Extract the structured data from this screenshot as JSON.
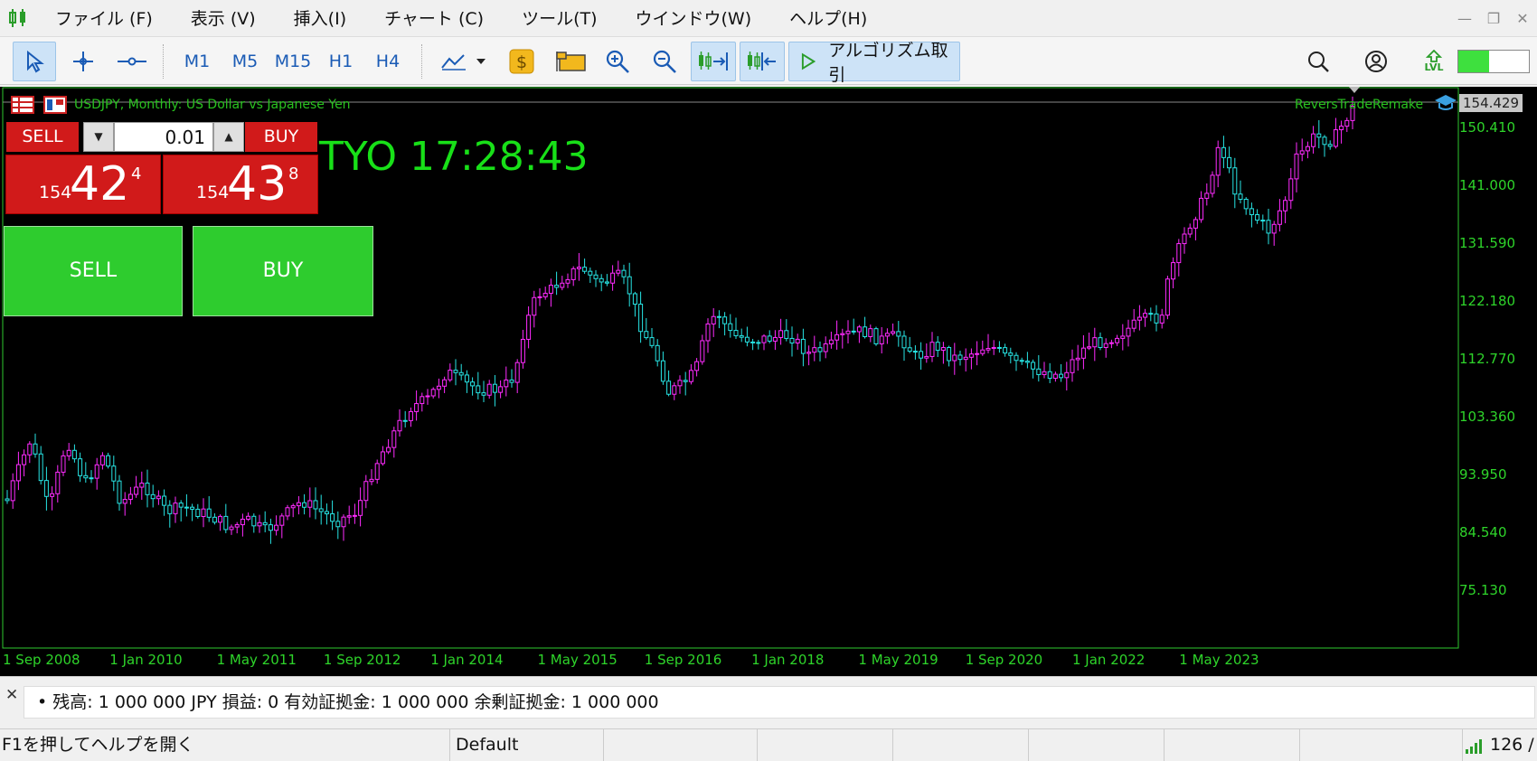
{
  "menu": {
    "items": [
      "ファイル (F)",
      "表示 (V)",
      "挿入(I)",
      "チャート (C)",
      "ツール(T)",
      "ウインドウ(W)",
      "ヘルプ(H)"
    ]
  },
  "toolbar": {
    "timeframes": [
      "M1",
      "M5",
      "M15",
      "H1",
      "H4"
    ],
    "algo_label": "アルゴリズム取引",
    "level_badge": "LVL"
  },
  "chart": {
    "title": "USDJPY, Monthly:  US Dollar vs Japanese Yen",
    "ea_name": "ReversTradeRemake",
    "last_price": "154.429",
    "price_labels": [
      "150.410",
      "141.000",
      "131.590",
      "122.180",
      "112.770",
      "103.360",
      "93.950",
      "84.540",
      "75.130"
    ],
    "date_labels": [
      "1 Sep 2008",
      "1 Jan 2010",
      "1 May 2011",
      "1 Sep 2012",
      "1 Jan 2014",
      "1 May 2015",
      "1 Sep 2016",
      "1 Jan 2018",
      "1 May 2019",
      "1 Sep 2020",
      "1 Jan 2022",
      "1 May 2023"
    ],
    "clock": "TYO 17:28:43",
    "colors": {
      "bull": "#ff2bff",
      "bear": "#27e5e5",
      "frame": "#2ec72e"
    }
  },
  "one_click": {
    "sell_label": "SELL",
    "buy_label": "BUY",
    "lot": "0.01",
    "sell_quote": {
      "prefix": "154",
      "big": "42",
      "sup": "4"
    },
    "buy_quote": {
      "prefix": "154",
      "big": "43",
      "sup": "8"
    }
  },
  "big_buttons": {
    "sell": "SELL",
    "buy": "BUY"
  },
  "trade_panel": {
    "summary": "•  残高: 1 000 000 JPY  損益: 0  有効証拠金: 1 000 000  余剰証拠金: 1 000 000"
  },
  "status_bar": {
    "help": "F1を押してヘルプを開く",
    "profile": "Default",
    "ping": "126 /"
  }
}
